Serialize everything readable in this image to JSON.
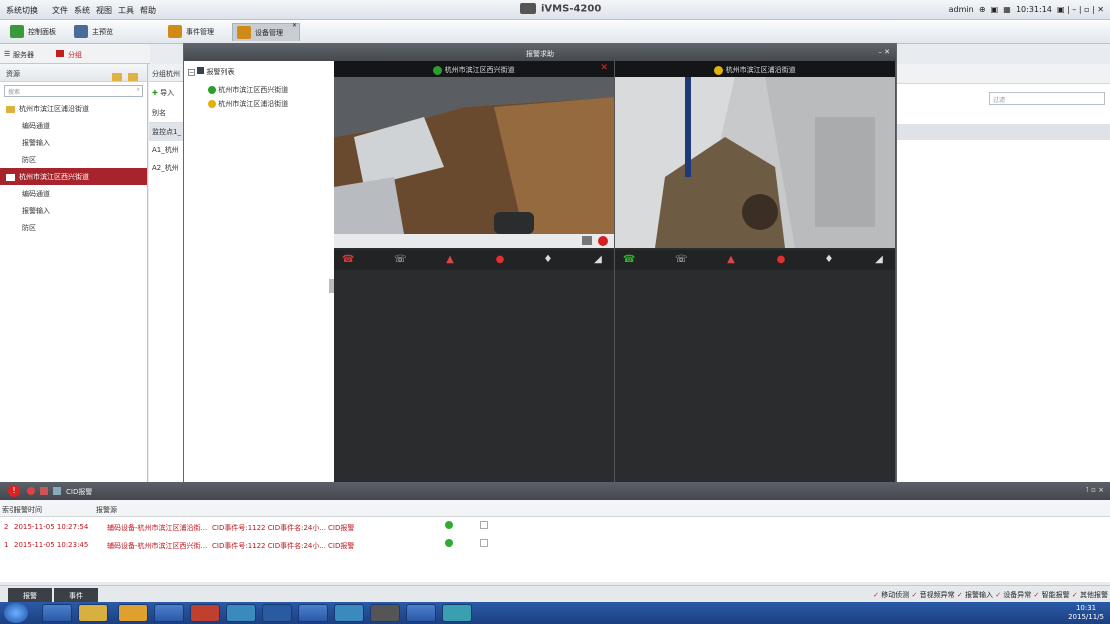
{
  "menubar": {
    "items": [
      "系统切换",
      "文件",
      "系统",
      "视图",
      "工具",
      "帮助"
    ],
    "app_title": "iVMS-4200",
    "user": "admin",
    "time": "10:31:14"
  },
  "tabs": [
    {
      "label": "控制面板",
      "color": "#3a9a3a"
    },
    {
      "label": "主预览",
      "color": "#4a6a9a"
    },
    {
      "label": "事件管理",
      "color": "#d08a18"
    },
    {
      "label": "设备管理",
      "color": "#d08a18"
    }
  ],
  "subtabs": {
    "encoder": "服务器",
    "group": "分组"
  },
  "left": {
    "header": "资源",
    "search_placeholder": "搜索",
    "tree": [
      {
        "label": "杭州市滨江区浦沿街道",
        "level": 0
      },
      {
        "label": "编码通道",
        "level": 1
      },
      {
        "label": "报警输入",
        "level": 1
      },
      {
        "label": "防区",
        "level": 1
      },
      {
        "label": "杭州市滨江区西兴街道",
        "level": 0,
        "selected": true
      },
      {
        "label": "编码通道",
        "level": 1
      },
      {
        "label": "报警输入",
        "level": 1
      },
      {
        "label": "防区",
        "level": 1
      }
    ]
  },
  "group": {
    "header": "分组杭州",
    "import": "导入",
    "alias": "别名",
    "rows": [
      "监控点1_",
      "A1_杭州",
      "A2_杭州"
    ]
  },
  "filter_placeholder": "过滤",
  "dialog": {
    "title": "报警求助",
    "list_title": "报警列表",
    "list": [
      {
        "label": "杭州市滨江区西兴街道",
        "status": "green"
      },
      {
        "label": "杭州市滨江区浦沿街道",
        "status": "yellow"
      }
    ],
    "panes": [
      {
        "title": "杭州市滨江区西兴街道",
        "status": "green"
      },
      {
        "title": "杭州市滨江区浦沿街道",
        "status": "yellow"
      }
    ]
  },
  "alarms": {
    "bar_label": "CID报警",
    "columns": {
      "index": "索引",
      "time": "报警时间",
      "source": "报警源"
    },
    "rows": [
      {
        "index": "2",
        "time": "2015-11-05 10:27:54",
        "source": "辅码设备-杭州市滨江区浦沿街...",
        "event": "CID事件号:1122 CID事件名:24小...",
        "type": "CID报警"
      },
      {
        "index": "1",
        "time": "2015-11-05 10:23:45",
        "source": "辅码设备-杭州市滨江区西兴街...",
        "event": "CID事件号:1122 CID事件名:24小...",
        "type": "CID报警"
      }
    ]
  },
  "status": {
    "tab_alarm": "报警",
    "tab_event": "事件",
    "checks": [
      "移动侦测",
      "音视频异常",
      "报警输入",
      "设备异常",
      "智能报警",
      "其他报警"
    ]
  },
  "clock": {
    "time": "10:31",
    "date": "2015/11/5"
  }
}
